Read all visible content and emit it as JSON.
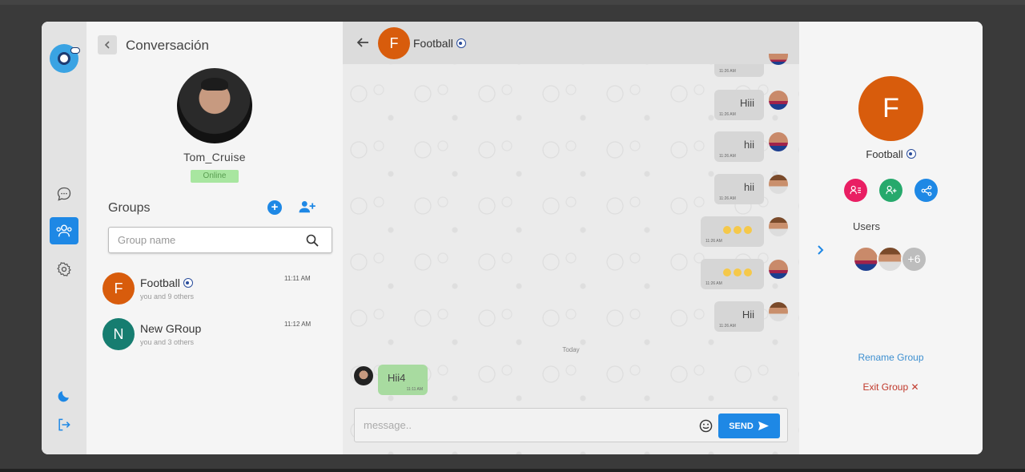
{
  "left": {
    "title": "Conversación",
    "profile": {
      "name": "Tom_Cruise",
      "status": "Online"
    },
    "groups_title": "Groups",
    "add_label": "+",
    "search": {
      "placeholder": "Group name"
    },
    "groups": [
      {
        "initial": "F",
        "name": "Football",
        "sub": "you and 9 others",
        "time": "11:11 AM",
        "color": "#d85c0c"
      },
      {
        "initial": "N",
        "name": "New GRoup",
        "sub": "you and 3 others",
        "time": "11:12 AM",
        "color": "#167d70"
      }
    ]
  },
  "chat": {
    "initial": "F",
    "title": "Football",
    "messages": [
      {
        "text": "",
        "time": "11:26 AM"
      },
      {
        "text": "Hiii",
        "time": "11:26 AM"
      },
      {
        "text": "hii",
        "time": "11:26 AM"
      },
      {
        "text": "hii",
        "time": "11:26 AM"
      },
      {
        "text": "",
        "time": "11:26 AM"
      },
      {
        "text": "",
        "time": "11:26 AM"
      },
      {
        "text": "Hii",
        "time": "11:26 AM"
      }
    ],
    "today": "Today",
    "incoming": {
      "text": "Hii4",
      "time": "11:11 AM"
    },
    "composer": {
      "placeholder": "message..",
      "send": "SEND"
    }
  },
  "right": {
    "initial": "F",
    "title": "Football",
    "users_label": "Users",
    "more_users": "+6",
    "rename": "Rename Group",
    "exit": "Exit Group ✕"
  },
  "colors": {
    "accent": "#1e88e5",
    "group_orange": "#d85c0c",
    "group_teal": "#167d70",
    "pink": "#e91e63",
    "green": "#26a96c",
    "bubble_in": "#a8dba0"
  },
  "icons": [
    "chat-icon",
    "users-icon",
    "gear-icon",
    "moon-icon",
    "logout-icon",
    "search-icon",
    "add-user-icon",
    "send-icon",
    "smile-icon",
    "back-arrow-icon",
    "chevron-right-icon",
    "soccer-ball-icon"
  ]
}
